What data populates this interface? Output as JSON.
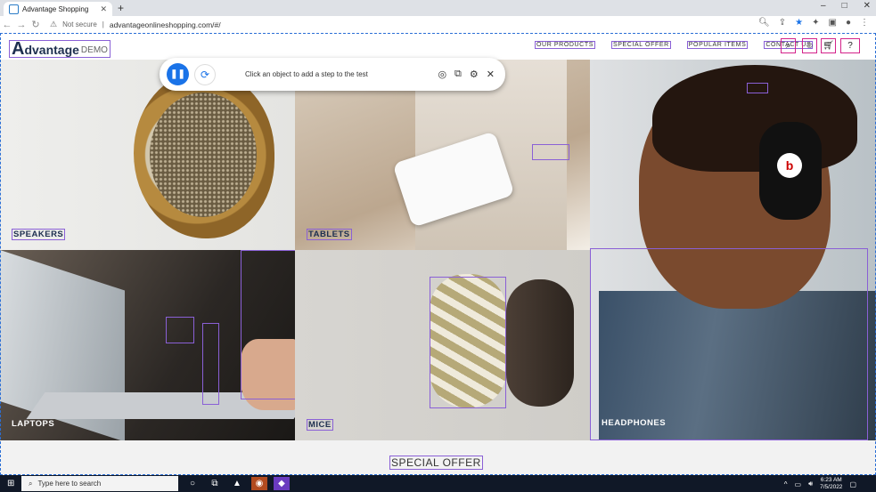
{
  "browser": {
    "tab_title": "Advantage Shopping",
    "new_tab": "+",
    "security": "Not secure",
    "url": "advantageonlineshopping.com/#/",
    "window_controls": [
      "–",
      "□",
      "✕"
    ]
  },
  "site": {
    "logo_main": "dvantage",
    "logo_letter": "A",
    "logo_sub": "DEMO",
    "menu": [
      "OUR PRODUCTS",
      "SPECIAL OFFER",
      "POPULAR ITEMS",
      "CONTACT US"
    ]
  },
  "recorder": {
    "message": "Click an object to add a step to the test"
  },
  "categories": {
    "speakers": "SPEAKERS",
    "tablets": "TABLETS",
    "headphones": "HEADPHONES",
    "laptops": "LAPTOPS",
    "mice": "MICE"
  },
  "special_offer": "SPECIAL OFFER",
  "taskbar": {
    "search_placeholder": "Type here to search",
    "time": "6:23 AM",
    "date": "7/5/2022"
  },
  "colors": {
    "highlight": "#8a60d6",
    "accent": "#d4238a",
    "chrome_blue": "#1a73e8"
  }
}
